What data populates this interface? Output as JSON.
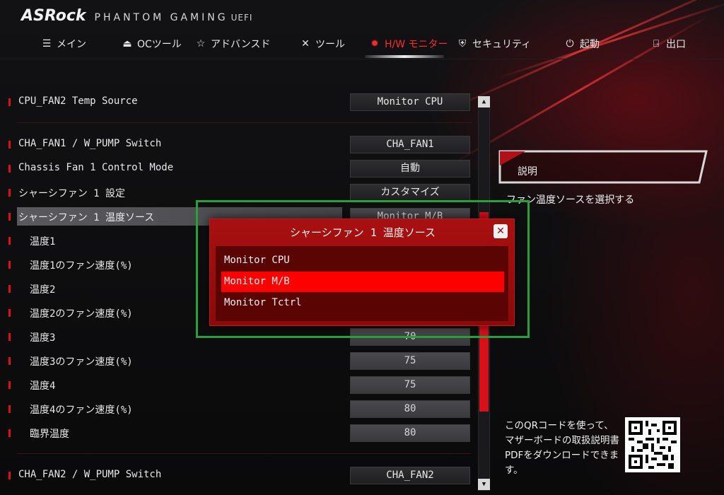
{
  "header": {
    "brand": "ASRock",
    "product": "PHANTOM GAMING",
    "suffix": "UEFI"
  },
  "nav": [
    {
      "label": "メイン",
      "icon": "list-icon"
    },
    {
      "label": "OCツール",
      "icon": "rocket-icon"
    },
    {
      "label": "アドバンスド",
      "icon": "star-icon"
    },
    {
      "label": "ツール",
      "icon": "tools-icon"
    },
    {
      "label": "H/W モニター",
      "icon": "monitor-icon",
      "active": true
    },
    {
      "label": "セキュリティ",
      "icon": "shield-icon"
    },
    {
      "label": "起動",
      "icon": "power-icon"
    },
    {
      "label": "出口",
      "icon": "exit-icon"
    }
  ],
  "settings": {
    "cpu_fan2_temp_source": {
      "label": "CPU_FAN2 Temp Source",
      "value": "Monitor CPU"
    },
    "cha_fan1_switch": {
      "label": "CHA_FAN1 / W_PUMP Switch",
      "value": "CHA_FAN1"
    },
    "chassis_fan1_mode": {
      "label": "Chassis Fan 1 Control Mode",
      "value": "自動"
    },
    "chassis_fan1_setting": {
      "label": "シャーシファン 1 設定",
      "value": "カスタマイズ"
    },
    "chassis_fan1_temp_source": {
      "label": "シャーシファン 1 温度ソース",
      "value": "Monitor M/B"
    },
    "temp1": {
      "label": "温度1"
    },
    "temp1_speed": {
      "label": "温度1のファン速度(%)"
    },
    "temp2": {
      "label": "温度2"
    },
    "temp2_speed": {
      "label": "温度2のファン速度(%)"
    },
    "temp3": {
      "label": "温度3",
      "value": "70"
    },
    "temp3_speed": {
      "label": "温度3のファン速度(%)",
      "value": "75"
    },
    "temp4": {
      "label": "温度4",
      "value": "75"
    },
    "temp4_speed": {
      "label": "温度4のファン速度(%)",
      "value": "80"
    },
    "critical_temp": {
      "label": "臨界温度",
      "value": "80"
    },
    "cha_fan2_switch": {
      "label": "CHA_FAN2 / W_PUMP Switch",
      "value": "CHA_FAN2"
    }
  },
  "description": {
    "title": "説明",
    "text": "ファン温度ソースを選択する"
  },
  "qr": {
    "text": "このQRコードを使って、マザーボードの取扱説明書PDFをダウンロードできます。"
  },
  "popup": {
    "title": "シャーシファン 1 温度ソース",
    "close": "✕",
    "options": [
      "Monitor CPU",
      "Monitor M/B",
      "Monitor Tctrl"
    ],
    "selected": 1
  },
  "colors": {
    "accent": "#ff0000",
    "popup_bg": "#a81010",
    "highlight_outline": "#2aa03a"
  }
}
